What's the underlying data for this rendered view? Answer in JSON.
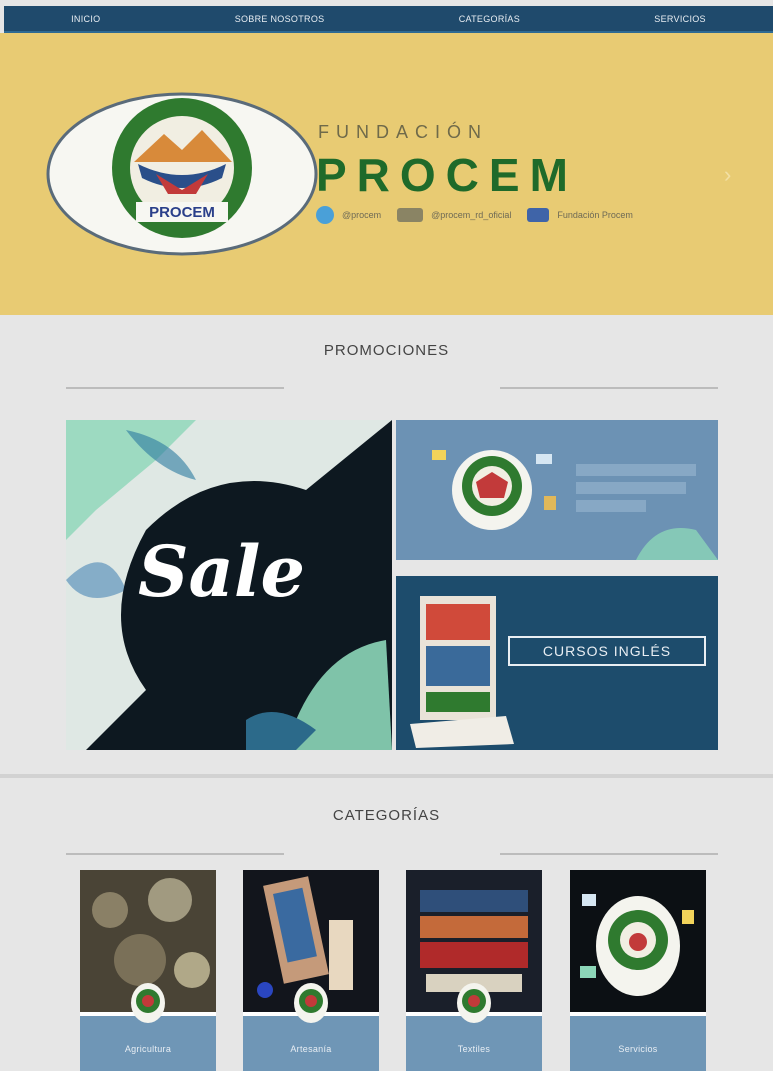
{
  "nav": {
    "items": [
      {
        "label": "Inicio"
      },
      {
        "label": "Sobre nosotros"
      },
      {
        "label": "Categorías"
      },
      {
        "label": "Servicios"
      }
    ]
  },
  "hero": {
    "brand_small": "Fundación",
    "brand_big": "PROCEM",
    "socials": [
      {
        "icon": "twitter-icon",
        "label": "@procem",
        "color": "#4aa0d8"
      },
      {
        "icon": "instagram-icon",
        "label": "@procem_rd_oficial",
        "color": "#8a8464"
      },
      {
        "icon": "facebook-icon",
        "label": "Fundación Procem",
        "color": "#3f64a8"
      }
    ],
    "logo_text": "PROCEM"
  },
  "promos": {
    "title": "PROMOCIONES",
    "sale_text": "Sale",
    "cursos_label": "CURSOS INGLÉS"
  },
  "categories": {
    "title": "CATEGORÍAS",
    "cards": [
      {
        "label": "Agricultura"
      },
      {
        "label": "Artesanía"
      },
      {
        "label": "Textiles"
      },
      {
        "label": "Servicios"
      }
    ]
  },
  "colors": {
    "nav_bg": "#1f4a6c",
    "hero_bg": "#e8cb73",
    "brand_green": "#1f6a2a",
    "accent_blue": "#6f96b6",
    "dark_blue": "#1d4c6c"
  }
}
